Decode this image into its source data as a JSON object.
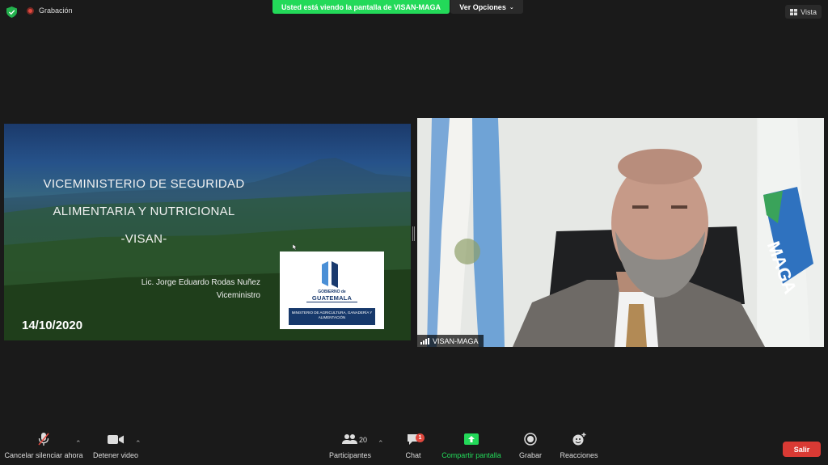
{
  "topbar": {
    "recording_label": "Grabación",
    "share_banner": "Usted está viendo la pantalla de VISAN-MAGA",
    "options_label": "Ver Opciones",
    "view_label": "Vista"
  },
  "slide": {
    "title_line1": "VICEMINISTERIO DE SEGURIDAD",
    "title_line2": "ALIMENTARIA Y NUTRICIONAL",
    "title_line3": "-VISAN-",
    "author": "Lic. Jorge Eduardo Rodas Nuñez",
    "role": "Viceministro",
    "date": "14/10/2020",
    "logo": {
      "gobierno": "GOBIERNO de",
      "guatemala": "GUATEMALA",
      "ministerio": "MINISTERIO DE AGRICULTURA, GANADERÍA Y ALIMENTACIÓN"
    }
  },
  "video": {
    "participant_name": "VISAN-MAGA",
    "flag_text": "MAGA"
  },
  "toolbar": {
    "mute_label": "Cancelar silenciar ahora",
    "video_label": "Detener video",
    "participants_label": "Participantes",
    "participants_count": "20",
    "chat_label": "Chat",
    "chat_badge": "1",
    "share_label": "Compartir pantalla",
    "record_label": "Grabar",
    "reactions_label": "Reacciones",
    "leave_label": "Salir"
  },
  "colors": {
    "background": "#1a1a1a",
    "share_green": "#23d959",
    "leave_red": "#d93a34"
  },
  "icons": [
    "shield-icon",
    "record-dot-icon",
    "chevron-down-icon",
    "grid-view-icon",
    "microphone-muted-icon",
    "video-camera-icon",
    "participants-icon",
    "chat-icon",
    "share-screen-icon",
    "record-icon",
    "reactions-icon",
    "signal-icon"
  ]
}
